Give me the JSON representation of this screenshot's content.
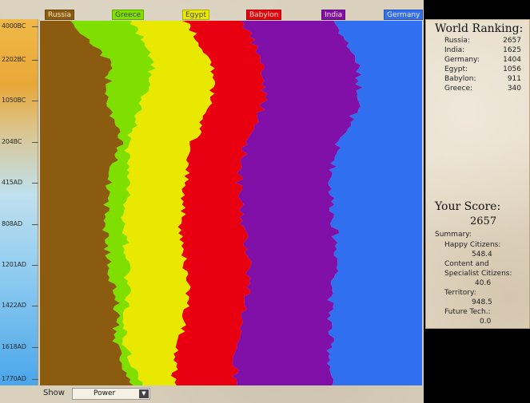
{
  "timeline": {
    "dates": [
      "4000BC",
      "2202BC",
      "1050BC",
      "204BC",
      "415AD",
      "808AD",
      "1201AD",
      "1422AD",
      "1618AD",
      "1770AD"
    ]
  },
  "legend": [
    {
      "name": "Russia",
      "color": "#8b5c10"
    },
    {
      "name": "Greece",
      "color": "#7fe000"
    },
    {
      "name": "Egypt",
      "color": "#e8e800"
    },
    {
      "name": "Babylon",
      "color": "#e80010"
    },
    {
      "name": "India",
      "color": "#8010a8"
    },
    {
      "name": "Germany",
      "color": "#3070f0"
    }
  ],
  "chart_data": {
    "type": "area",
    "stacked": true,
    "normalized": true,
    "orientation": "vertical",
    "x_label": "",
    "x": [
      "4000BC",
      "2202BC",
      "1050BC",
      "204BC",
      "415AD",
      "808AD",
      "1201AD",
      "1422AD",
      "1618AD",
      "1770AD"
    ],
    "series": [
      {
        "name": "Russia",
        "color": "#8b5c10",
        "values": [
          0.08,
          0.18,
          0.18,
          0.21,
          0.18,
          0.17,
          0.18,
          0.2,
          0.2,
          0.24
        ]
      },
      {
        "name": "Greece",
        "color": "#7fe000",
        "values": [
          0.16,
          0.12,
          0.09,
          0.02,
          0.05,
          0.05,
          0.05,
          0.03,
          0.02,
          0.03
        ]
      },
      {
        "name": "Egypt",
        "color": "#e8e800",
        "values": [
          0.14,
          0.15,
          0.18,
          0.17,
          0.15,
          0.15,
          0.15,
          0.16,
          0.14,
          0.08
        ]
      },
      {
        "name": "Babylon",
        "color": "#e80010",
        "values": [
          0.15,
          0.13,
          0.14,
          0.14,
          0.14,
          0.16,
          0.17,
          0.15,
          0.15,
          0.16
        ]
      },
      {
        "name": "India",
        "color": "#8010a8",
        "values": [
          0.24,
          0.25,
          0.25,
          0.24,
          0.24,
          0.24,
          0.23,
          0.22,
          0.25,
          0.25
        ]
      },
      {
        "name": "Germany",
        "color": "#3070f0",
        "values": [
          0.23,
          0.17,
          0.16,
          0.22,
          0.24,
          0.23,
          0.22,
          0.24,
          0.24,
          0.24
        ]
      }
    ]
  },
  "bottom": {
    "show_label": "Show",
    "show_value": "Power"
  },
  "ranking": {
    "title": "World Ranking:",
    "rows": [
      {
        "name": "Russia:",
        "score": "2657"
      },
      {
        "name": "India:",
        "score": "1625"
      },
      {
        "name": "Germany:",
        "score": "1404"
      },
      {
        "name": "Egypt:",
        "score": "1056"
      },
      {
        "name": "Babylon:",
        "score": "911"
      },
      {
        "name": "Greece:",
        "score": "340"
      }
    ]
  },
  "score": {
    "title": "Your Score:",
    "value": "2657",
    "summary_label": "Summary:",
    "happy_label": "Happy Citizens:",
    "happy_value": "548.4",
    "content_label_1": "Content and",
    "content_label_2": "Specialist Citizens:",
    "content_value": "40.6",
    "territory_label": "Territory:",
    "territory_value": "948.5",
    "future_label": "Future Tech.:",
    "future_value": "0.0"
  }
}
